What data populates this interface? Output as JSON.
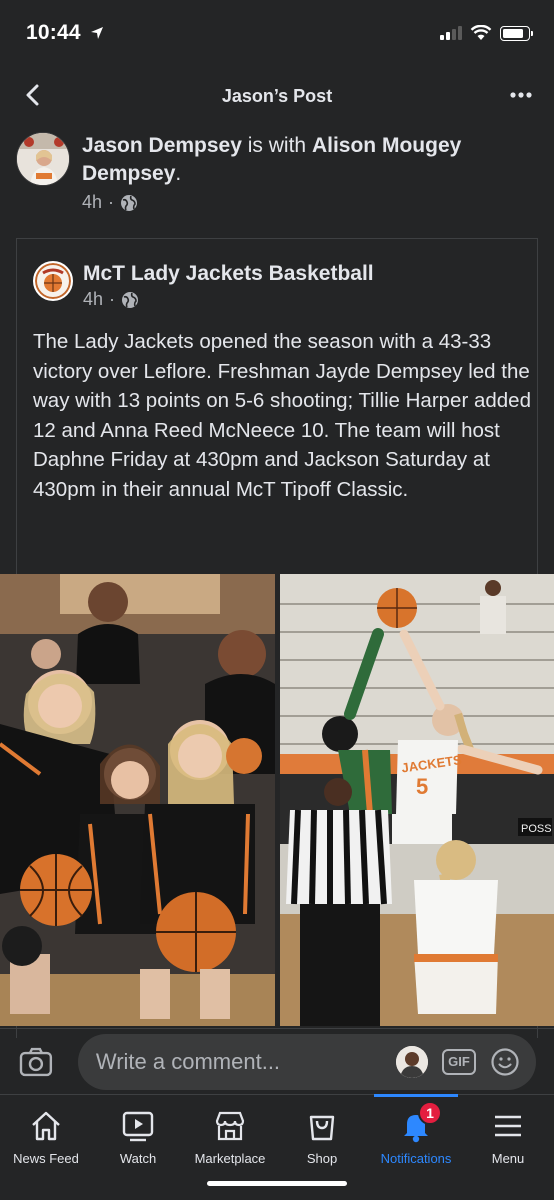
{
  "status_bar": {
    "time": "10:44"
  },
  "header": {
    "title": "Jason’s Post"
  },
  "post": {
    "author": "Jason Dempsey",
    "with_text": "is with",
    "tagged": "Alison Mougey Dempsey",
    "end_punct": ".",
    "time": "4h",
    "separator": "·"
  },
  "shared": {
    "page_name": "McT Lady Jackets Basketball",
    "time": "4h",
    "separator": "·",
    "body": "The Lady Jackets opened the season with a 43-33 victory over Leflore. Freshman Jayde Dempsey led the way with 13 points on 5-6 shooting; Tillie Harper added 12 and Anna Reed McNeece 10. The team will host Daphne Friday at 430pm and Jackson Saturday at 430pm in their annual McT Tipoff Classic.",
    "photo_texts": {
      "jersey_text": "JACKETS",
      "jersey_number": "5",
      "banner_text": "POSS"
    }
  },
  "comment_bar": {
    "placeholder": "Write a comment...",
    "gif_label": "GIF"
  },
  "nav": {
    "items": [
      {
        "label": "News Feed",
        "icon": "home-icon"
      },
      {
        "label": "Watch",
        "icon": "watch-icon"
      },
      {
        "label": "Marketplace",
        "icon": "marketplace-icon"
      },
      {
        "label": "Shop",
        "icon": "shop-icon"
      },
      {
        "label": "Notifications",
        "icon": "bell-icon",
        "badge": "1",
        "active": true
      },
      {
        "label": "Menu",
        "icon": "menu-icon"
      }
    ]
  },
  "colors": {
    "background": "#242526",
    "accent": "#2d88ff",
    "badge": "#e41e3f"
  }
}
